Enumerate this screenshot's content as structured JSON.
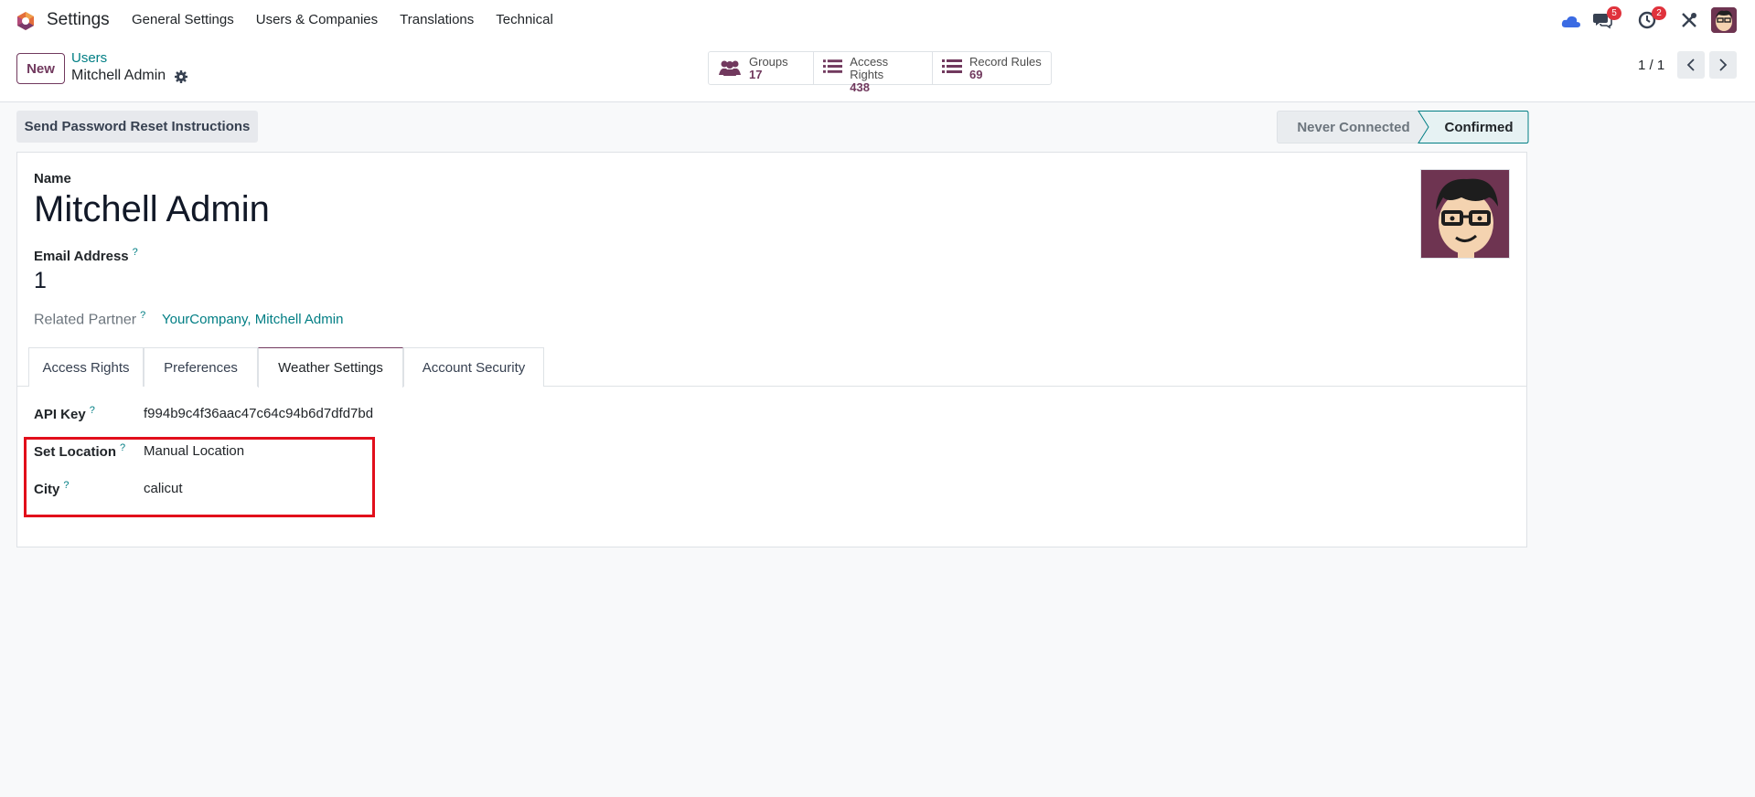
{
  "navbar": {
    "app_name": "Settings",
    "menu": [
      "General Settings",
      "Users & Companies",
      "Translations",
      "Technical"
    ],
    "messages_count": "5",
    "activities_count": "2"
  },
  "control_panel": {
    "new_label": "New",
    "breadcrumb_parent": "Users",
    "breadcrumb_current": "Mitchell Admin",
    "smart_buttons": [
      {
        "label": "Groups",
        "value": "17",
        "icon": "users-icon"
      },
      {
        "label": "Access Rights",
        "value": "438",
        "icon": "list-icon"
      },
      {
        "label": "Record Rules",
        "value": "69",
        "icon": "list-icon"
      }
    ],
    "pager": "1 / 1"
  },
  "status": {
    "reset_button": "Send Password Reset Instructions",
    "stages": [
      "Never Connected",
      "Confirmed"
    ],
    "active_stage": "Confirmed"
  },
  "form": {
    "name_label": "Name",
    "name_value": "Mitchell Admin",
    "email_label": "Email Address",
    "email_value": "1",
    "partner_label": "Related Partner",
    "partner_value": "YourCompany, Mitchell Admin",
    "help_mark": "?",
    "tabs": [
      "Access Rights",
      "Preferences",
      "Weather Settings",
      "Account Security"
    ],
    "active_tab": "Weather Settings",
    "fields": [
      {
        "label": "API Key",
        "value": "f994b9c4f36aac47c64c94b6d7dfd7bd"
      },
      {
        "label": "Set Location",
        "value": "Manual Location"
      },
      {
        "label": "City",
        "value": "calicut"
      }
    ]
  },
  "colors": {
    "brand": "#71395e",
    "link": "#017e84",
    "highlight_box": "#e20f1b",
    "badge": "#e0323c"
  }
}
